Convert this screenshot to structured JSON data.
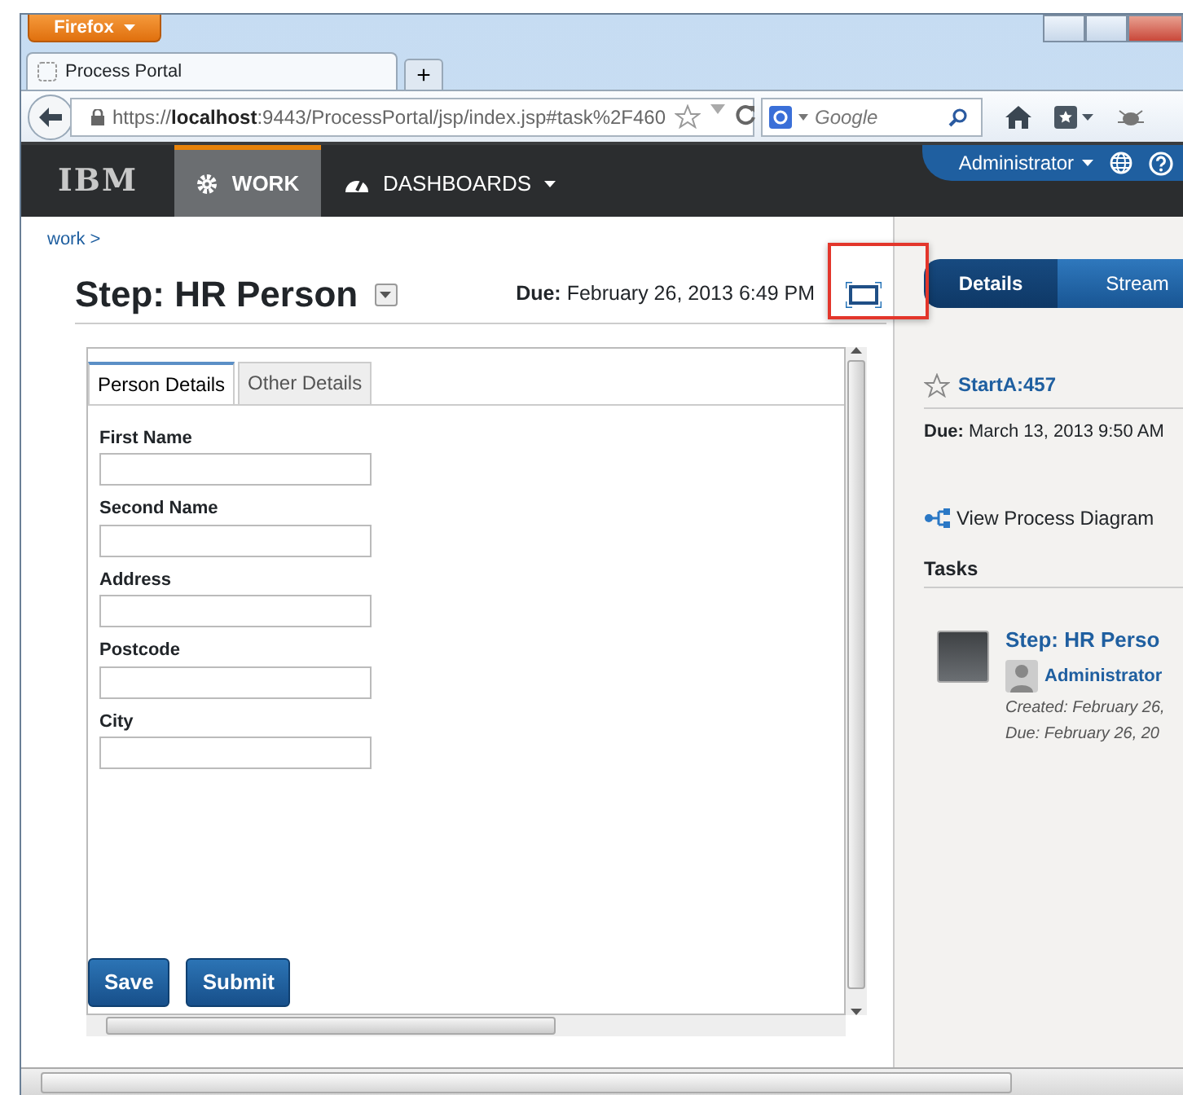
{
  "browser": {
    "menu_button": "Firefox",
    "tab": {
      "title": "Process Portal"
    },
    "new_tab": "+",
    "url": {
      "prefix": "https://",
      "host": "localhost",
      "rest": ":9443/ProcessPortal/jsp/index.jsp#task%2F460"
    },
    "search": {
      "placeholder": "Google"
    }
  },
  "portal": {
    "logo": "IBM",
    "nav": [
      {
        "label": "WORK",
        "selected": true,
        "dropdown": false
      },
      {
        "label": "DASHBOARDS",
        "selected": false,
        "dropdown": true
      }
    ],
    "user": "Administrator"
  },
  "breadcrumb": "work >",
  "task": {
    "title": "Step: HR Person",
    "due": "**Due:** February 26, 2013 6:49 PM"
  },
  "form": {
    "tabs": [
      {
        "label": "Person Details",
        "selected": true
      },
      {
        "label": "Other Details",
        "selected": false
      }
    ],
    "fields": [
      {
        "label": "First Name"
      },
      {
        "label": "Second Name"
      },
      {
        "label": "Address"
      },
      {
        "label": "Postcode"
      },
      {
        "label": "City"
      }
    ],
    "buttons": [
      "Save",
      "Submit"
    ]
  },
  "side": {
    "tabs": [
      {
        "label": "Details",
        "selected": true
      },
      {
        "label": "Stream",
        "selected": false
      }
    ],
    "instance": "StartA:457",
    "due": "**Due:** March 13, 2013 9:50 AM",
    "diagram_link": "View Process Diagram",
    "tasks_heading": "Tasks",
    "tasks": [
      {
        "title": "Step: HR Perso",
        "owner": "Administrator",
        "created": "Created: February 26,",
        "due": "Due: February 26, 20"
      }
    ]
  }
}
